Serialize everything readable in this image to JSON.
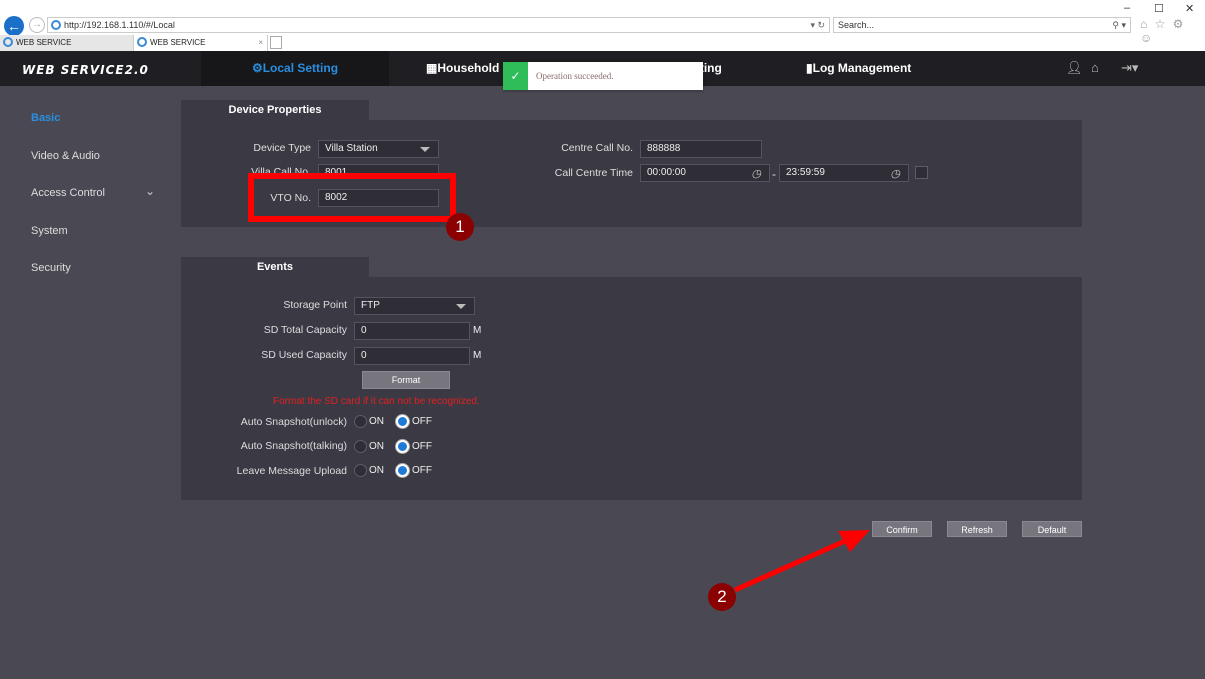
{
  "browser": {
    "url": "http://192.168.1.110/#/Local",
    "search_placeholder": "Search...",
    "tabs": [
      "WEB SERVICE",
      "WEB SERVICE"
    ],
    "win_controls": [
      "–",
      "☐",
      "✕"
    ],
    "toolbar_icons": "⌂ ☆ ⚙ ☺"
  },
  "header": {
    "logo": "WEB SERVICE2.0",
    "nav": [
      {
        "label": "Local Setting",
        "icon": "gear-icon"
      },
      {
        "label": "Household Setting",
        "icon": "building-icon"
      },
      {
        "label": "Network Setting",
        "icon": "globe-icon"
      },
      {
        "label": "Log Management",
        "icon": "document-icon"
      }
    ]
  },
  "toast": {
    "message": "Operation succeeded."
  },
  "sidebar": {
    "items": [
      {
        "label": "Basic"
      },
      {
        "label": "Video & Audio"
      },
      {
        "label": "Access Control"
      },
      {
        "label": "System"
      },
      {
        "label": "Security"
      }
    ]
  },
  "device_properties": {
    "title": "Device Properties",
    "device_type_label": "Device Type",
    "device_type": "Villa Station",
    "villa_call_label": "Villa Call No.",
    "villa_call": "8001",
    "vto_label": "VTO No.",
    "vto": "8002",
    "centre_call_label": "Centre Call No.",
    "centre_call": "888888",
    "call_centre_time_label": "Call Centre Time",
    "time_start": "00:00:00",
    "time_sep": "-",
    "time_end": "23:59:59"
  },
  "events": {
    "title": "Events",
    "storage_label": "Storage Point",
    "storage": "FTP",
    "total_label": "SD Total Capacity",
    "total": "0",
    "used_label": "SD Used Capacity",
    "used": "0",
    "unit": "M",
    "format_btn": "Format",
    "warning": "Format the SD card if it can not be recognized.",
    "on": "ON",
    "off": "OFF",
    "options": [
      {
        "label": "Auto Snapshot(unlock)",
        "value": "OFF"
      },
      {
        "label": "Auto Snapshot(talking)",
        "value": "OFF"
      },
      {
        "label": "Leave Message Upload",
        "value": "OFF"
      }
    ]
  },
  "actions": {
    "confirm": "Confirm",
    "refresh": "Refresh",
    "default": "Default"
  },
  "annotations": {
    "step1": "1",
    "step2": "2"
  },
  "colors": {
    "accent": "#2a8ee0",
    "success": "#2ebd59",
    "warning": "#e02020",
    "annotation": "#ff0000"
  }
}
